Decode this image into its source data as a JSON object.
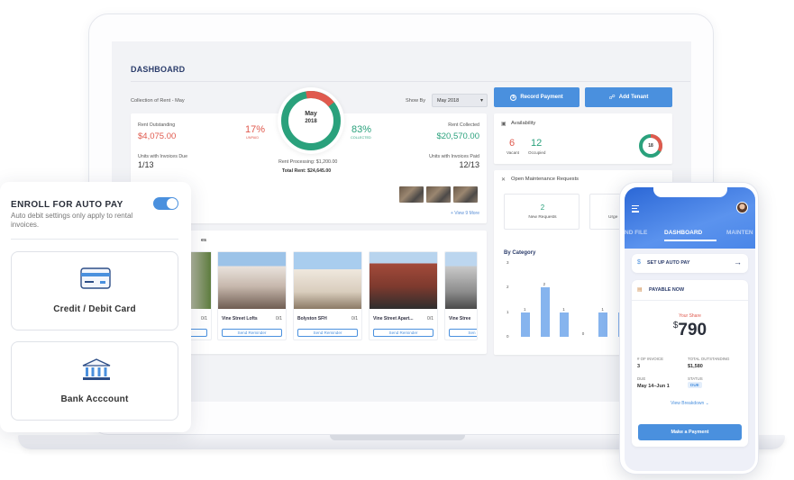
{
  "dashboard": {
    "title": "DASHBOARD",
    "collection_label": "Collection of Rent - May",
    "show_by_label": "Show By",
    "show_by_value": "May 2018",
    "rent_outstanding_label": "Rent Outstanding",
    "rent_outstanding_value": "$4,075.00",
    "unpaid_pct": "17%",
    "unpaid_label": "UNPAID",
    "collected_pct": "83%",
    "collected_label": "COLLECTED",
    "rent_collected_label": "Rent Collected",
    "rent_collected_value": "$20,570.00",
    "donut_month": "May",
    "donut_year": "2018",
    "units_due_label": "Units with Invoices Due",
    "units_due_value": "1/13",
    "units_paid_label": "Units with Invoices Paid",
    "units_paid_value": "12/13",
    "rent_processing": "Rent Processing: $1,200.00",
    "total_rent": "Total Rent: $24,645.00",
    "view_more": "+ View 9 More",
    "properties_header": "es",
    "properties": [
      {
        "name": "",
        "count": "0/1",
        "button": "der"
      },
      {
        "name": "Vine Street Lofts",
        "count": "0/1",
        "button": "Send Reminder"
      },
      {
        "name": "Bolyston SFH",
        "count": "0/1",
        "button": "Send Reminder"
      },
      {
        "name": "Vine Street Apart...",
        "count": "0/1",
        "button": "Send Reminder"
      },
      {
        "name": "Vine Stree",
        "count": "",
        "button": "Sen"
      }
    ]
  },
  "actions": {
    "record_payment": "Record Payment",
    "add_tenant": "Add Tenant"
  },
  "availability": {
    "title": "Availability",
    "vacant_value": "6",
    "vacant_label": "Vacant",
    "occupied_value": "12",
    "occupied_label": "Occupied",
    "total": "18"
  },
  "maintenance": {
    "title": "Open Maintenance Requests",
    "new_value": "2",
    "new_label": "New Requests",
    "urgent_label": "Urge",
    "category_title": "By Category"
  },
  "chart_data": {
    "type": "bar",
    "title": "By Category",
    "categories": [
      "",
      "",
      "",
      "",
      "",
      ""
    ],
    "values": [
      1,
      2,
      1,
      0,
      1,
      1
    ],
    "data_labels": [
      "1",
      "2",
      "1",
      "0",
      "1",
      ""
    ],
    "y_ticks": [
      "0",
      "1",
      "2",
      "3"
    ],
    "ylim": [
      0,
      3
    ],
    "grid": false,
    "bar_color": "#86b4ee"
  },
  "autopay": {
    "title": "ENROLL FOR AUTO PAY",
    "subtitle": "Auto debit settings only apply to rental invoices.",
    "toggle_on": true,
    "card_option": "Credit / Debit Card",
    "bank_option": "Bank Acccount"
  },
  "mobile": {
    "tab_left": "ND FILE",
    "tab_center": "DASHBOARD",
    "tab_right": "MAINTEN",
    "setup_autopay": "SET UP AUTO PAY",
    "payable_now": "PAYABLE NOW",
    "your_share_label": "Your Share",
    "currency": "$",
    "amount": "790",
    "invoice_label": "# OF INVOICE",
    "invoice_value": "3",
    "outstanding_label": "TOTAL OUTSTANDING",
    "outstanding_value": "$1,580",
    "due_label": "DUE",
    "due_value": "May 14–Jun 1",
    "status_label": "STATUS",
    "status_value": "DUE",
    "view_breakdown": "View Breakdown",
    "make_payment": "Make a Payment"
  },
  "colors": {
    "accent": "#4a90de",
    "unpaid": "#e05a4e",
    "collected": "#2aa17c",
    "title": "#2b3c6b"
  }
}
